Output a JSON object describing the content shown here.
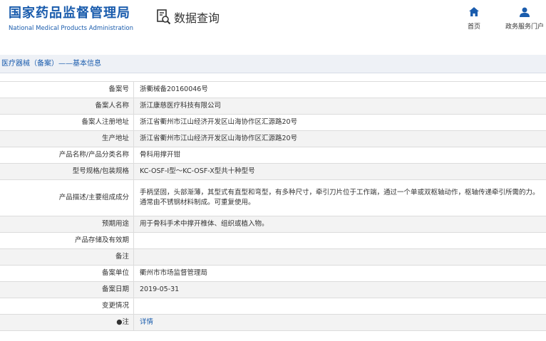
{
  "site": {
    "name_cn": "国家药品监督管理局",
    "name_en": "National Medical Products Administration"
  },
  "query": {
    "title": "数据查询",
    "icon": "search-document-icon"
  },
  "nav": [
    {
      "label": "首页",
      "icon": "home-icon"
    },
    {
      "label": "政务服务门户",
      "icon": "user-icon"
    }
  ],
  "section": {
    "title": "医疗器械（备案）——基本信息"
  },
  "colors": {
    "brand": "#1a5cad",
    "section_bg": "#eef1f6",
    "row_alt": "#f3f3f3"
  },
  "rows": [
    {
      "label": "备案号",
      "value": "浙衢械备20160046号"
    },
    {
      "label": "备案人名称",
      "value": "浙江康慈医疗科技有限公司"
    },
    {
      "label": "备案人注册地址",
      "value": "浙江省衢州市江山经济开发区山海协作区汇源路20号"
    },
    {
      "label": "生产地址",
      "value": "浙江省衢州市江山经济开发区山海协作区汇源路20号"
    },
    {
      "label": "产品名称/产品分类名称",
      "value": "骨科用撑开钳"
    },
    {
      "label": "型号规格/包装规格",
      "value": "KC-OSF-I型～KC-OSF-X型共十种型号"
    },
    {
      "label": "产品描述/主要组成成分",
      "value": "手柄坚固，头部渐薄，其型式有直型和弯型，有多种尺寸，牵引刀片位于工作端，通过一个单或双枢轴动作，枢轴传递牵引所需的力。通常由不锈钢材料制成。可重复使用。"
    },
    {
      "label": "预期用途",
      "value": "用于骨科手术中撑开椎体、组织或植入物。"
    },
    {
      "label": "产品存储及有效期",
      "value": ""
    },
    {
      "label": "备注",
      "value": ""
    },
    {
      "label": "备案单位",
      "value": "衢州市市场监督管理局"
    },
    {
      "label": "备案日期",
      "value": "2019-05-31"
    },
    {
      "label": "变更情况",
      "value": ""
    },
    {
      "label": "注",
      "value": "详情",
      "note_icon": "bullet-icon"
    }
  ]
}
